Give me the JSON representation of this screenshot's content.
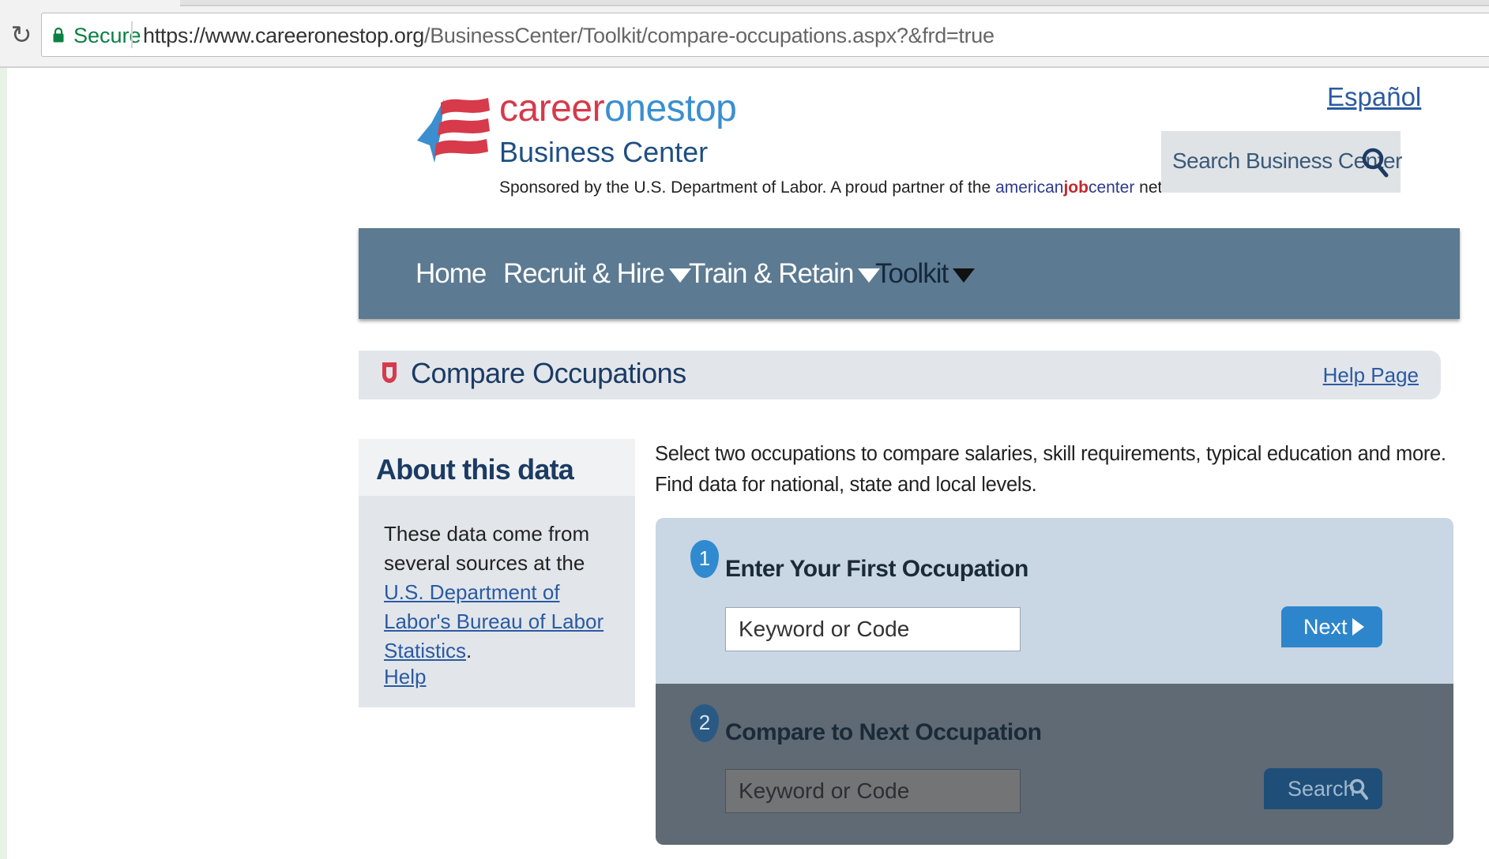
{
  "browser": {
    "secure_label": "Secure",
    "url_host": "https://www.careeronestop.org",
    "url_path": "/BusinessCenter/Toolkit/compare-occupations.aspx?&frd=true"
  },
  "header": {
    "brand_career": "career",
    "brand_onestop": "onestop",
    "brand_sub": "Business Center",
    "sponsor_text": "Sponsored by the U.S. Department of Labor. A proud partner of the",
    "ajc_american": "american",
    "ajc_job": "job",
    "ajc_center": "center",
    "sponsor_end": "network.",
    "language_link": "Español",
    "search_label": "Search Business Center",
    "search_icon": "magnifier-icon"
  },
  "nav": {
    "items": [
      {
        "label": "Home"
      },
      {
        "label": "Recruit & Hire"
      },
      {
        "label": "Train & Retain"
      },
      {
        "label": "Toolkit"
      }
    ]
  },
  "page": {
    "title": "Compare Occupations",
    "help_link": "Help Page"
  },
  "about": {
    "title": "About this data",
    "text_before": "These data come from several sources at the",
    "link_text": "U.S. Department of Labor's Bureau of Labor Statistics",
    "text_after": ".",
    "help_link": "Help"
  },
  "intro": "Select two occupations to compare salaries, skill requirements, typical education and more. Find data for national, state and local levels.",
  "steps": [
    {
      "number": "1",
      "title": "Enter Your First Occupation",
      "placeholder": "Keyword or Code",
      "button": "Next"
    },
    {
      "number": "2",
      "title": "Compare to Next Occupation",
      "placeholder": "Keyword or Code",
      "button": "Search"
    }
  ],
  "colors": {
    "nav_bg": "#5c7a91",
    "brand_red": "#d63a4b",
    "brand_blue": "#3b8fd0",
    "heading_navy": "#1c3b63",
    "link_blue": "#2b5aa1"
  }
}
